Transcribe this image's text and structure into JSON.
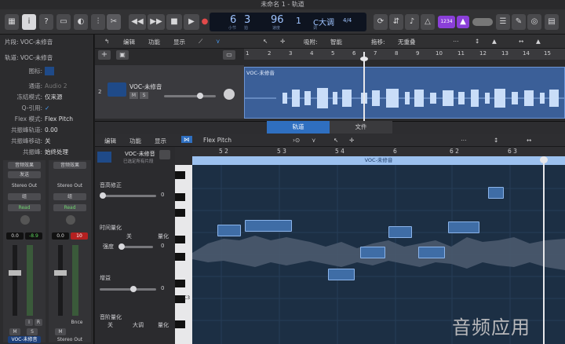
{
  "window": {
    "title": "未命名 1 - 轨道"
  },
  "toolbar": {
    "count_bars": "1",
    "lcd": {
      "bar": "6",
      "beat": "3",
      "tempo": "96",
      "ts_num": "4",
      "ts_den": "4",
      "key": "C大调",
      "sig": "4/4",
      "bar_lbl": "小节",
      "beat_lbl": "拍",
      "div_lbl": "拍子",
      "tempo_lbl": "速度",
      "tone_lbl": "调"
    },
    "badge": "1234"
  },
  "inspector": {
    "section_region": "片段: VOC-未修音",
    "section_track": "轨道: VOC-未修音",
    "icon_label": "图标:",
    "channel_label": "通道:",
    "channel_value": "Audio 2",
    "freeze_label": "冻结模式:",
    "freeze_value": "仅来源",
    "q_label": "Q-引用:",
    "q_value": "✓",
    "flex_label": "Flex 模式:",
    "flex_value": "Flex Pitch",
    "share_label": "共振峰轨道:",
    "share_value": "0.00",
    "shift_label": "共振峰移动:",
    "shift_value": "关",
    "track_label": "共振峰:",
    "track_value": "始终处理"
  },
  "strips": [
    {
      "audio_fx": "音频效果",
      "send": "发送",
      "output": "Stereo Out",
      "group": "组",
      "auto": "Read",
      "pan_l": "0.0",
      "pan_r": "-8.9",
      "name": "VOC-未修音",
      "m": "M",
      "s": "S",
      "i": "I",
      "r": "R"
    },
    {
      "audio_fx": "音频效果",
      "send": "",
      "output": "Stereo Out",
      "group": "组",
      "auto": "Read",
      "pan_l": "0.0",
      "pan_r": "10",
      "name": "Stereo Out",
      "m": "M",
      "s": "",
      "bnce": "Bnce"
    }
  ],
  "tracks_toolbar": {
    "edit": "编辑",
    "func": "功能",
    "view": "显示",
    "snap_lbl": "吸附:",
    "snap_val": "智能",
    "drag_lbl": "拖移:",
    "drag_val": "无重叠"
  },
  "ruler_top": [
    "1",
    "2",
    "3",
    "4",
    "5",
    "6",
    "7",
    "8",
    "9",
    "10",
    "11",
    "12",
    "13",
    "14",
    "15"
  ],
  "track": {
    "number": "2",
    "name": "VOC-未修音",
    "m": "M",
    "s": "S",
    "region_name": "VOC-未修音"
  },
  "editor": {
    "tab_track": "轨道",
    "tab_file": "文件",
    "edit": "编辑",
    "func": "功能",
    "view": "显示",
    "flex": "Flex Pitch",
    "region_name": "VOC-未修音",
    "region_sub": "已选定所有片段",
    "pitch_label": "音高修正",
    "pitch_val": "0",
    "time_label": "时间量化",
    "time_val": "关",
    "quantize": "量化",
    "strength_label": "强度",
    "strength_val": "0",
    "gain_label": "增益",
    "gain_val": "0",
    "scale_label": "音阶量化",
    "scale_val": "关",
    "scale_key": "大调",
    "c3": "C3",
    "ruler": [
      "5 2",
      "5 3",
      "5 4",
      "6",
      "6 2",
      "6 3"
    ]
  },
  "watermark": "音频应用"
}
